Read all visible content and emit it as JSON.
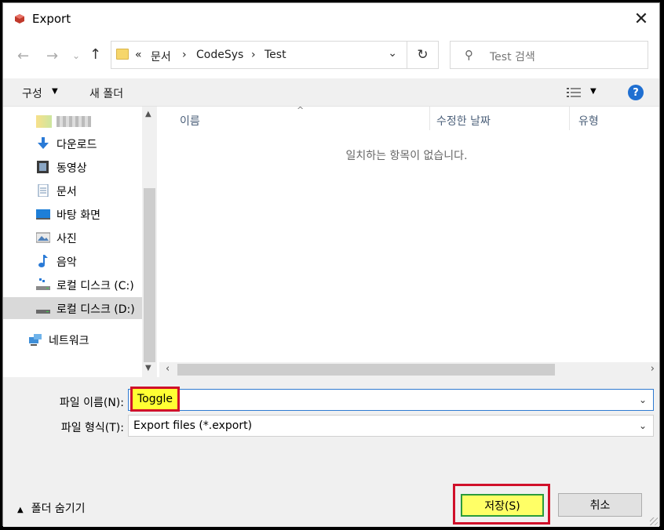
{
  "window": {
    "title": "Export",
    "close_glyph": "✕"
  },
  "nav": {
    "back_glyph": "←",
    "forward_glyph": "→",
    "recent_glyph": "⌄",
    "up_glyph": "↑",
    "breadcrumb_overflow": "«",
    "breadcrumb": [
      "문서",
      "CodeSys",
      "Test"
    ],
    "refresh_glyph": "↻",
    "search_placeholder": "Test 검색"
  },
  "toolbar": {
    "organize": "구성",
    "new_folder": "새 폴더",
    "help": "?"
  },
  "sidebar": {
    "items": [
      {
        "label": "",
        "icon": "quick-access-icon"
      },
      {
        "label": "다운로드",
        "icon": "download-icon"
      },
      {
        "label": "동영상",
        "icon": "video-icon"
      },
      {
        "label": "문서",
        "icon": "document-icon"
      },
      {
        "label": "바탕 화면",
        "icon": "desktop-icon"
      },
      {
        "label": "사진",
        "icon": "picture-icon"
      },
      {
        "label": "음악",
        "icon": "music-icon"
      },
      {
        "label": "로컬 디스크 (C:)",
        "icon": "drive-icon"
      },
      {
        "label": "로컬 디스크 (D:)",
        "icon": "drive-icon"
      },
      {
        "label": "네트워크",
        "icon": "network-icon"
      }
    ]
  },
  "filelist": {
    "columns": [
      "이름",
      "수정한 날짜",
      "유형"
    ],
    "empty_message": "일치하는 항목이 없습니다."
  },
  "form": {
    "filename_label": "파일 이름(N):",
    "filename_value": "Toggle",
    "filetype_label": "파일 형식(T):",
    "filetype_value": "Export files (*.export)"
  },
  "buttons": {
    "hide_folders": "폴더 숨기기",
    "save": "저장(S)",
    "cancel": "취소"
  },
  "colors": {
    "highlight": "#ffff33",
    "annotation_border": "#d0102a",
    "help_blue": "#1f6fd1"
  }
}
